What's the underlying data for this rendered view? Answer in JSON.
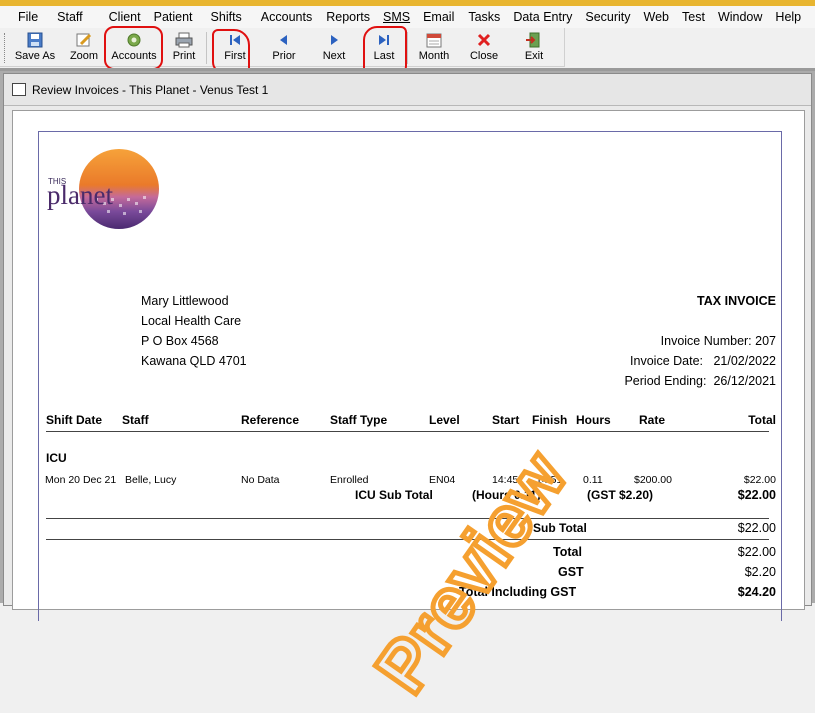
{
  "menu": [
    "File",
    "Staff",
    "Client",
    "Patient",
    "Shifts",
    "Accounts",
    "Reports",
    "SMS",
    "Email",
    "Tasks",
    "Data Entry",
    "Security",
    "Web",
    "Test",
    "Window",
    "Help"
  ],
  "toolbar": {
    "save_as": "Save As",
    "zoom": "Zoom",
    "accounts": "Accounts",
    "print": "Print",
    "first": "First",
    "prior": "Prior",
    "next": "Next",
    "last": "Last",
    "month": "Month",
    "close": "Close",
    "exit": "Exit"
  },
  "window": {
    "title": "Review Invoices  -  This Planet - Venus Test 1"
  },
  "logo": {
    "top": "THIS",
    "word": "planet"
  },
  "invoice": {
    "recipient": [
      "Mary Littlewood",
      "Local Health Care",
      "P O Box 4568",
      "Kawana  QLD  4701"
    ],
    "heading": "TAX INVOICE",
    "invoice_number_label": "Invoice Number:",
    "invoice_number": "207",
    "invoice_date_label": "Invoice Date:",
    "invoice_date": "21/02/2022",
    "period_ending_label": "Period Ending:",
    "period_ending": "26/12/2021",
    "columns": {
      "shift_date": "Shift Date",
      "staff": "Staff",
      "reference": "Reference",
      "staff_type": "Staff Type",
      "level": "Level",
      "start": "Start",
      "finish": "Finish",
      "hours": "Hours",
      "rate": "Rate",
      "total": "Total"
    },
    "group": "ICU",
    "row": {
      "date": "Mon 20 Dec 21",
      "staff": "Belle, Lucy",
      "reference": "No Data",
      "staff_type": "Enrolled",
      "level": "EN04",
      "start": "14:45",
      "finish": "14:51",
      "hours": "0.11",
      "rate": "$200.00",
      "total": "$22.00"
    },
    "icu_subtotal_label": "ICU Sub Total",
    "icu_hours": "(Hours 0.11)",
    "icu_gst": "(GST $2.20)",
    "icu_subtotal": "$22.00",
    "subtotal_label": "Sub Total",
    "subtotal": "$22.00",
    "total_label": "Total",
    "total": "$22.00",
    "gst_label": "GST",
    "gst": "$2.20",
    "total_incl_label": "Total Including GST",
    "total_incl": "$24.20"
  },
  "watermark": "Preview",
  "colors": {
    "accent_red": "#e01010",
    "watermark": "#f5a030",
    "frame": "#6a6aa8"
  }
}
